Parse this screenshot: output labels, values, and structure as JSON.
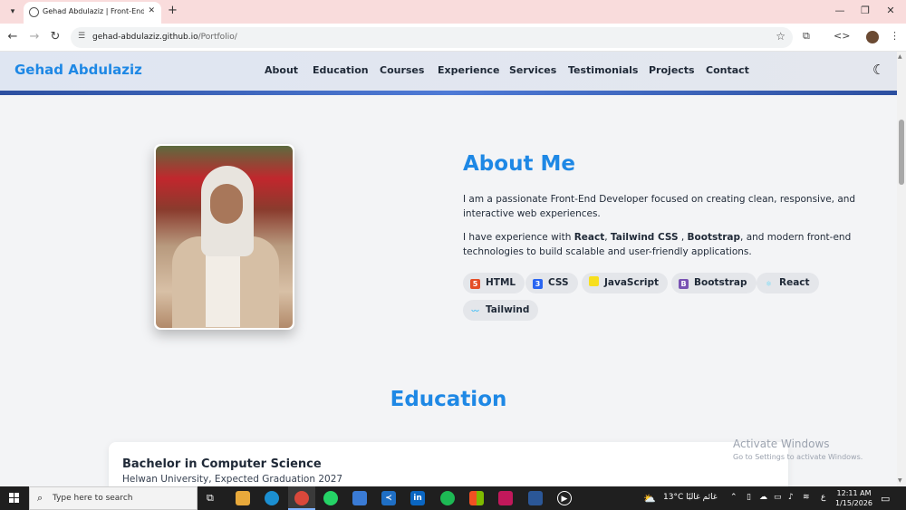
{
  "browser": {
    "tab_title": "Gehad Abdulaziz | Front-End D",
    "url_host": "gehad-abdulaziz.github.io",
    "url_path": "/Portfolio/"
  },
  "site": {
    "logo": "Gehad Abdulaziz",
    "nav": [
      "About",
      "Education",
      "Courses",
      "Experience",
      "Services",
      "Testimonials",
      "Projects",
      "Contact"
    ]
  },
  "about": {
    "title": "About Me",
    "para1": "I am a passionate Front-End Developer focused on creating clean, responsive, and interactive web experiences.",
    "para2_prefix": "I have experience with ",
    "para2_react": "React",
    "para2_sep1": ", ",
    "para2_tailwind": "Tailwind CSS",
    "para2_sep2": " , ",
    "para2_bootstrap": "Bootstrap",
    "para2_suffix": ", and modern front-end technologies to build scalable and user-friendly applications.",
    "skills": [
      {
        "label": "HTML",
        "icon": "html5-icon",
        "color": "#e44d26"
      },
      {
        "label": "CSS",
        "icon": "css3-icon",
        "color": "#2965f1"
      },
      {
        "label": "JavaScript",
        "icon": "javascript-icon",
        "color": "#f7df1e"
      },
      {
        "label": "Bootstrap",
        "icon": "bootstrap-icon",
        "color": "#7952b3"
      },
      {
        "label": "React",
        "icon": "react-icon",
        "color": "#61dafb"
      },
      {
        "label": "Tailwind",
        "icon": "tailwind-icon",
        "color": "#38bdf8"
      }
    ]
  },
  "education": {
    "title": "Education",
    "degree": "Bachelor in Computer Science",
    "school": "Helwan University, Expected Graduation 2027"
  },
  "watermark": {
    "title": "Activate Windows",
    "subtitle": "Go to Settings to activate Windows."
  },
  "taskbar": {
    "search_placeholder": "Type here to search",
    "weather": "13°C  غائم غالبًا",
    "lang": "ع",
    "time": "12:11 AM",
    "date": "1/15/2026"
  },
  "colors": {
    "accent": "#1e88e5",
    "header_bar": "#2c4fa0"
  }
}
